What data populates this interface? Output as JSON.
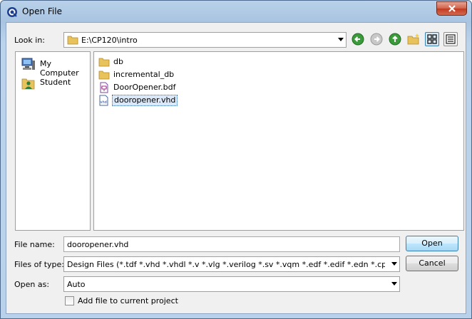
{
  "window": {
    "title": "Open File"
  },
  "look_in": {
    "label": "Look in:",
    "path": "E:\\CP120\\intro",
    "nav_buttons": [
      "back-icon",
      "forward-icon",
      "up-folder-icon",
      "new-folder-icon"
    ],
    "view_buttons": [
      "detail-view-icon",
      "list-view-icon"
    ]
  },
  "sidebar": {
    "items": [
      {
        "label": "My Computer",
        "icon": "computer-icon"
      },
      {
        "label": "Student",
        "icon": "user-folder-icon"
      }
    ]
  },
  "files": [
    {
      "name": "db",
      "icon": "folder-icon",
      "selected": false
    },
    {
      "name": "incremental_db",
      "icon": "folder-icon",
      "selected": false
    },
    {
      "name": "DoorOpener.bdf",
      "icon": "bdf-file-icon",
      "selected": false
    },
    {
      "name": "dooropener.vhd",
      "icon": "vhd-file-icon",
      "selected": true
    }
  ],
  "file_name": {
    "label": "File name:",
    "value": "dooropener.vhd"
  },
  "files_of_type": {
    "label": "Files of type:",
    "value": "Design Files (*.tdf *.vhd *.vhdl *.v *.vlg *.verilog *.sv *.vqm *.edf *.edif *.edn *.cpp *.md"
  },
  "open_as": {
    "label": "Open as:",
    "value": "Auto"
  },
  "add_to_project": {
    "label": "Add file to current project",
    "checked": false
  },
  "buttons": {
    "open": "Open",
    "cancel": "Cancel"
  },
  "colors": {
    "accent": "#3c7fb1",
    "folder": "#e8c25a",
    "title_bar": "#b9d1ea",
    "close": "#c13a22"
  }
}
